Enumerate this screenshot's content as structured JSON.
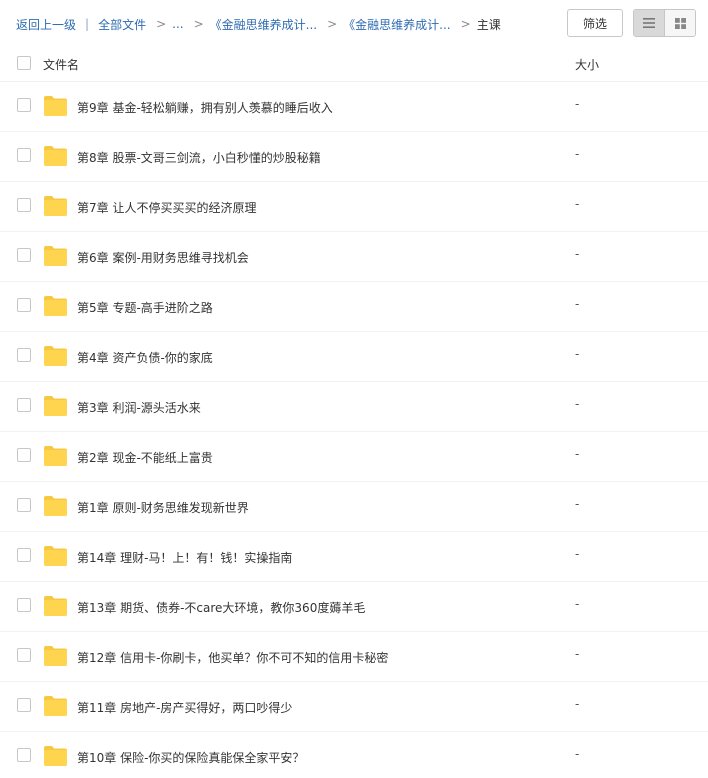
{
  "breadcrumb": {
    "back": "返回上一级",
    "separator": "|",
    "all_files": "全部文件",
    "ellipsis": "...",
    "arrow": ">",
    "crumb1": "《金融思维养成计...",
    "crumb2": "《金融思维养成计...",
    "current": "主课"
  },
  "toolbar": {
    "filter_label": "筛选",
    "view_list_icon": "list-icon",
    "view_grid_icon": "grid-icon"
  },
  "columns": {
    "name": "文件名",
    "size": "大小"
  },
  "colors": {
    "link": "#2e6bb3",
    "folder": "#ffd54f",
    "folder_tab": "#f7c843"
  },
  "files": [
    {
      "name": "第9章 基金-轻松躺赚，拥有别人羡慕的睡后收入",
      "size": "-"
    },
    {
      "name": "第8章 股票-文哥三剑流，小白秒懂的炒股秘籍",
      "size": "-"
    },
    {
      "name": "第7章 让人不停买买买的经济原理",
      "size": "-"
    },
    {
      "name": "第6章 案例-用财务思维寻找机会",
      "size": "-"
    },
    {
      "name": "第5章 专题-高手进阶之路",
      "size": "-"
    },
    {
      "name": "第4章 资产负债-你的家底",
      "size": "-"
    },
    {
      "name": "第3章 利润-源头活水来",
      "size": "-"
    },
    {
      "name": "第2章 现金-不能纸上富贵",
      "size": "-"
    },
    {
      "name": "第1章 原则-财务思维发现新世界",
      "size": "-"
    },
    {
      "name": "第14章 理财-马！上！有！钱！实操指南",
      "size": "-"
    },
    {
      "name": "第13章 期货、债券-不care大环境，教你360度薅羊毛",
      "size": "-"
    },
    {
      "name": "第12章 信用卡-你刷卡，他买单？你不可不知的信用卡秘密",
      "size": "-"
    },
    {
      "name": "第11章 房地产-房产买得好，两口吵得少",
      "size": "-"
    },
    {
      "name": "第10章 保险-你买的保险真能保全家平安？",
      "size": "-"
    }
  ]
}
